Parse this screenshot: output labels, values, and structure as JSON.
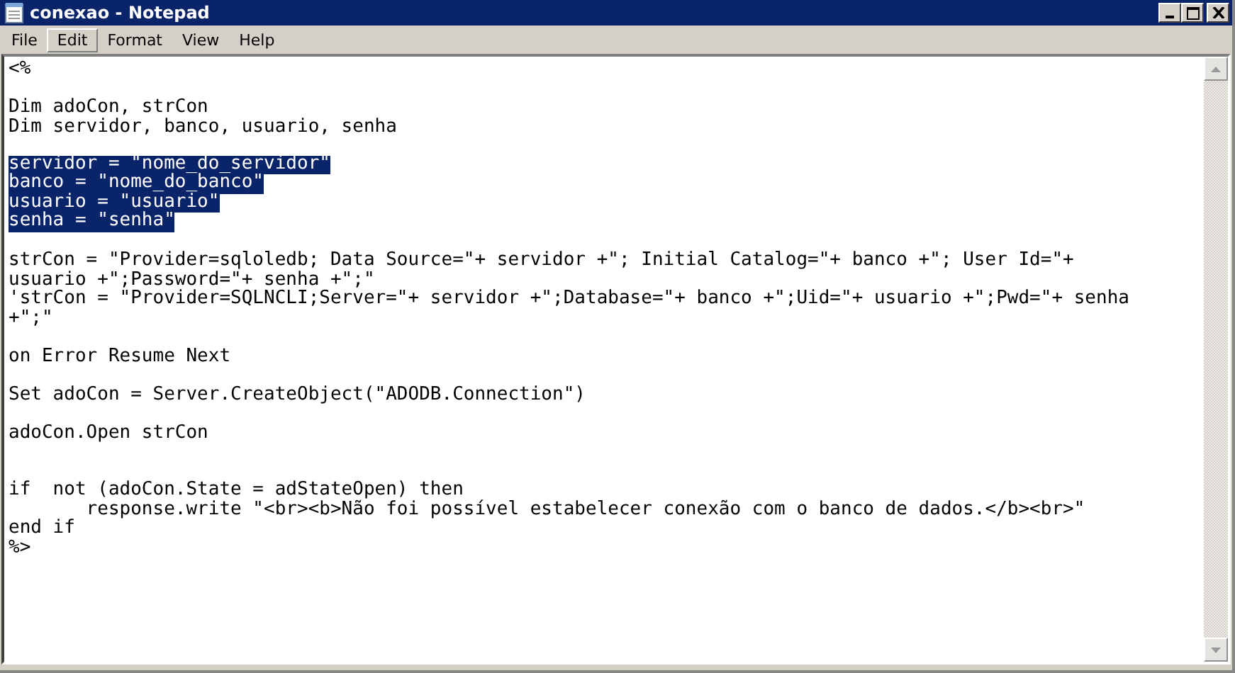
{
  "window": {
    "title": "conexao - Notepad"
  },
  "menu": [
    {
      "label": "File",
      "selected": false
    },
    {
      "label": "Edit",
      "selected": true
    },
    {
      "label": "Format",
      "selected": false
    },
    {
      "label": "View",
      "selected": false
    },
    {
      "label": "Help",
      "selected": false
    }
  ],
  "lines": [
    {
      "kind": "code",
      "text": "<%",
      "selected": false
    },
    {
      "kind": "blank"
    },
    {
      "kind": "code",
      "text": "Dim adoCon, strCon",
      "selected": false
    },
    {
      "kind": "code",
      "text": "Dim servidor, banco, usuario, senha",
      "selected": false
    },
    {
      "kind": "blank"
    },
    {
      "kind": "code",
      "text": "servidor = \"nome_do_servidor\"",
      "selected": true
    },
    {
      "kind": "code",
      "text": "banco = \"nome_do_banco\"",
      "selected": true
    },
    {
      "kind": "code",
      "text": "usuario = \"usuario\"",
      "selected": true
    },
    {
      "kind": "code",
      "text": "senha = \"senha\"",
      "selected": true
    },
    {
      "kind": "blank"
    },
    {
      "kind": "code",
      "text": "strCon = \"Provider=sqloledb; Data Source=\"+ servidor +\"; Initial Catalog=\"+ banco +\"; User Id=\"+",
      "selected": false
    },
    {
      "kind": "code",
      "text": "usuario +\";Password=\"+ senha +\";\"",
      "selected": false
    },
    {
      "kind": "code",
      "text": "'strCon = \"Provider=SQLNCLI;Server=\"+ servidor +\";Database=\"+ banco +\";Uid=\"+ usuario +\";Pwd=\"+ senha",
      "selected": false
    },
    {
      "kind": "code",
      "text": "+\";\"",
      "selected": false
    },
    {
      "kind": "blank"
    },
    {
      "kind": "code",
      "text": "on Error Resume Next",
      "selected": false
    },
    {
      "kind": "blank"
    },
    {
      "kind": "code",
      "text": "Set adoCon = Server.CreateObject(\"ADODB.Connection\")",
      "selected": false
    },
    {
      "kind": "blank"
    },
    {
      "kind": "code",
      "text": "adoCon.Open strCon",
      "selected": false
    },
    {
      "kind": "blank"
    },
    {
      "kind": "blank"
    },
    {
      "kind": "code",
      "text": "if  not (adoCon.State = adStateOpen) then",
      "selected": false
    },
    {
      "kind": "code",
      "text": "       response.write \"<br><b>Não foi possível estabelecer conexão com o banco de dados.</b><br>\"",
      "selected": false
    },
    {
      "kind": "code",
      "text": "end if",
      "selected": false
    },
    {
      "kind": "code",
      "text": "%>",
      "selected": false
    }
  ]
}
